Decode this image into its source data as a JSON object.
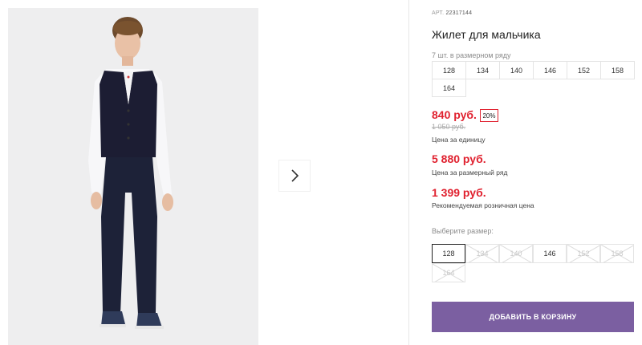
{
  "product": {
    "art_prefix": "АРТ.",
    "art_number": "22317144",
    "title": "Жилет для мальчика"
  },
  "size_range": {
    "caption": "7 шт. в размерном ряду",
    "sizes": [
      "128",
      "134",
      "140",
      "146",
      "152",
      "158",
      "164"
    ]
  },
  "pricing": {
    "price": "840 руб.",
    "discount": "20%",
    "old_price": "1 050 руб.",
    "unit_note": "Цена за единицу",
    "range_price": "5 880 руб.",
    "range_note": "Цена за размерный ряд",
    "retail_price": "1 399 руб.",
    "retail_note": "Рекомендуемая розничная цена",
    "accent_color": "#e0212f"
  },
  "size_select": {
    "caption": "Выберите размер:",
    "options": [
      {
        "label": "128",
        "state": "selected"
      },
      {
        "label": "134",
        "state": "disabled"
      },
      {
        "label": "140",
        "state": "disabled"
      },
      {
        "label": "146",
        "state": "available"
      },
      {
        "label": "152",
        "state": "disabled"
      },
      {
        "label": "158",
        "state": "disabled"
      },
      {
        "label": "164",
        "state": "disabled"
      }
    ]
  },
  "cart": {
    "button_label": "ДОБАВИТЬ В КОРЗИНУ",
    "button_color": "#7b5fa1"
  },
  "gallery": {
    "next_icon": "chevron-right-icon"
  }
}
